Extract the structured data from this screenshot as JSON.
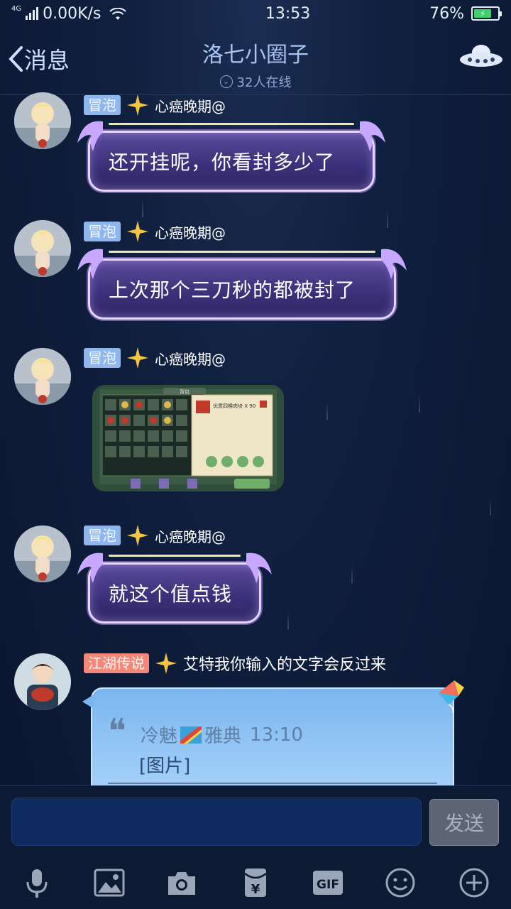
{
  "status_bar": {
    "network": "4G",
    "speed": "0.00K/s",
    "time": "13:53",
    "battery_percent": "76%",
    "battery_level": 76
  },
  "header": {
    "back_label": "消息",
    "title": "洛七小圈子",
    "online": "32人在线"
  },
  "messages": [
    {
      "badge": "冒泡",
      "name": "心癌晚期@",
      "text": "还开挂呢，你看封多少了"
    },
    {
      "badge": "冒泡",
      "name": "心癌晚期@",
      "text": "上次那个三刀秒的都被封了"
    },
    {
      "badge": "冒泡",
      "name": "心癌晚期@",
      "image_title": "背包",
      "item_name": "优质四喉肉块 X 90"
    },
    {
      "badge": "冒泡",
      "name": "心癌晚期@",
      "text": "就这个值点钱"
    },
    {
      "badge": "江湖传说",
      "name": "艾特我你输入的文字会反过来",
      "quote_author": "冷魅",
      "quote_author2": "雅典",
      "quote_time": "13:10",
      "quote_text": "[图片]"
    }
  ],
  "input": {
    "placeholder": "",
    "send_label": "发送"
  },
  "toolbar": {
    "gif_label": "GIF",
    "items": [
      "microphone-icon",
      "image-icon",
      "camera-icon",
      "red-packet-icon",
      "gif-icon",
      "emoji-icon",
      "plus-icon"
    ]
  },
  "colors": {
    "background": "#0f1a33",
    "bubble_purple": "#3a2f78",
    "bubble_blue": "#a9d3fb",
    "badge_blue": "#8fb7ee",
    "badge_red": "#f3877a",
    "send_button": "#5b6573"
  }
}
